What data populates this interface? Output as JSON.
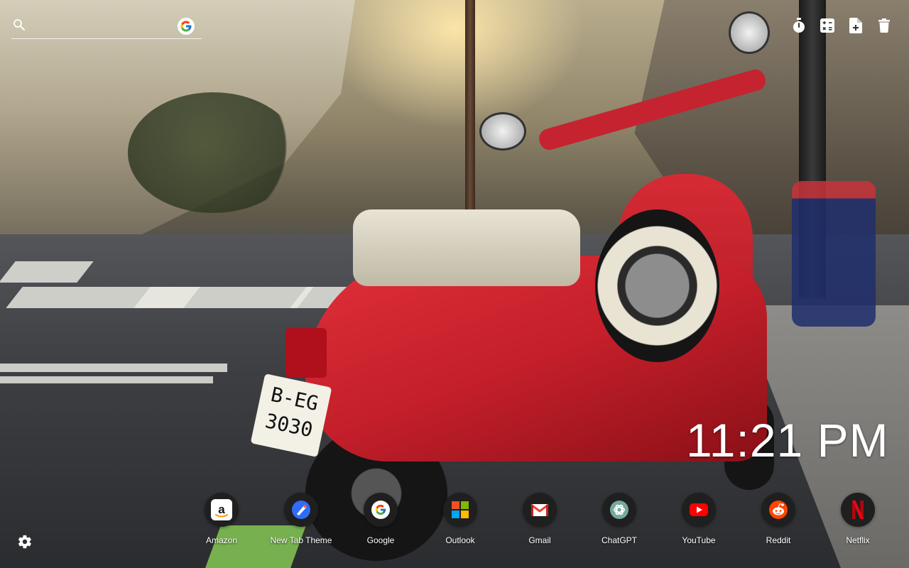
{
  "search": {
    "placeholder": "",
    "icon": "search-icon",
    "engine_icon": "google-icon"
  },
  "toolbar": [
    {
      "name": "timer",
      "icon": "stopwatch-icon"
    },
    {
      "name": "calculator",
      "icon": "calculator-icon"
    },
    {
      "name": "new-note",
      "icon": "file-plus-icon"
    },
    {
      "name": "delete",
      "icon": "trash-icon"
    }
  ],
  "clock": {
    "time": "11:21 PM"
  },
  "shortcuts": [
    {
      "label": "Amazon",
      "icon": "amazon-icon",
      "color": "#ffffff"
    },
    {
      "label": "New Tab Theme",
      "icon": "new-tab-theme-icon",
      "color": "#2f6df6"
    },
    {
      "label": "Google",
      "icon": "google-icon",
      "color": "#ffffff"
    },
    {
      "label": "Outlook",
      "icon": "microsoft-icon",
      "color": "#f25022"
    },
    {
      "label": "Gmail",
      "icon": "gmail-icon",
      "color": "#ea4335"
    },
    {
      "label": "ChatGPT",
      "icon": "chatgpt-icon",
      "color": "#ffffff"
    },
    {
      "label": "YouTube",
      "icon": "youtube-icon",
      "color": "#ff0000"
    },
    {
      "label": "Reddit",
      "icon": "reddit-icon",
      "color": "#ff4500"
    },
    {
      "label": "Netflix",
      "icon": "netflix-icon",
      "color": "#e50914"
    }
  ],
  "settings": {
    "icon": "gear-icon"
  },
  "background": {
    "plate_line1": "B-EG",
    "plate_line2": "3030"
  }
}
